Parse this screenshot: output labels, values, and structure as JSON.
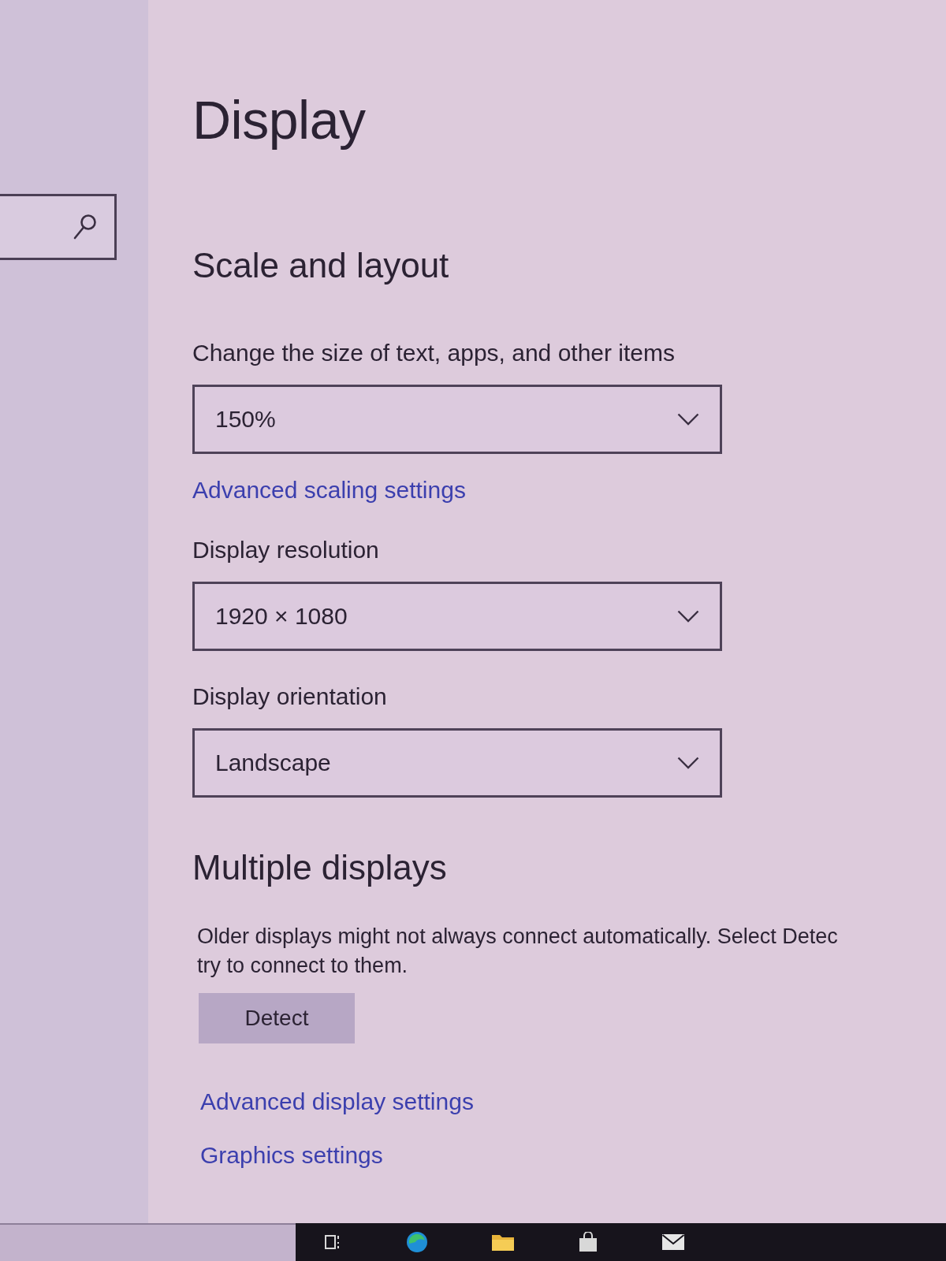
{
  "window": {
    "title": "Display"
  },
  "sections": [
    {
      "heading": "Scale and layout",
      "items": [
        {
          "kind": "dropdown",
          "label": "Change the size of text, apps, and other items",
          "value": "150%"
        },
        {
          "kind": "link",
          "text": "Advanced scaling settings"
        },
        {
          "kind": "dropdown",
          "label": "Display resolution",
          "value": "1920 × 1080"
        },
        {
          "kind": "dropdown",
          "label": "Display orientation",
          "value": "Landscape"
        }
      ]
    },
    {
      "heading": "Multiple displays",
      "items": [
        {
          "kind": "text",
          "text": "Older displays might not always connect automatically. Select Detec\ntry to connect to them."
        },
        {
          "kind": "button",
          "text": "Detect"
        },
        {
          "kind": "link",
          "text": "Advanced display settings"
        },
        {
          "kind": "link",
          "text": "Graphics settings"
        }
      ]
    }
  ]
}
